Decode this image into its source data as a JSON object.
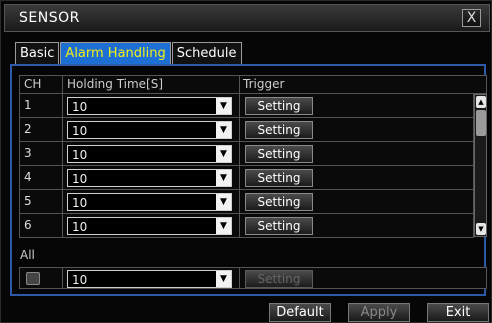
{
  "window": {
    "title": "SENSOR",
    "close_label": "X"
  },
  "tabs": [
    {
      "label": "Basic",
      "active": false
    },
    {
      "label": "Alarm Handling",
      "active": true
    },
    {
      "label": "Schedule",
      "active": false
    }
  ],
  "table": {
    "headers": {
      "ch": "CH",
      "holding_time": "Holding Time[S]",
      "trigger": "Trigger"
    },
    "rows": [
      {
        "ch": "1",
        "holding_time": "10",
        "trigger": "Setting"
      },
      {
        "ch": "2",
        "holding_time": "10",
        "trigger": "Setting"
      },
      {
        "ch": "3",
        "holding_time": "10",
        "trigger": "Setting"
      },
      {
        "ch": "4",
        "holding_time": "10",
        "trigger": "Setting"
      },
      {
        "ch": "5",
        "holding_time": "10",
        "trigger": "Setting"
      },
      {
        "ch": "6",
        "holding_time": "10",
        "trigger": "Setting"
      }
    ]
  },
  "all": {
    "label": "All",
    "holding_time": "10",
    "trigger": "Setting",
    "checked": false
  },
  "footer": {
    "default_label": "Default",
    "apply_label": "Apply",
    "exit_label": "Exit"
  },
  "colors": {
    "accent": "#1e6fd4",
    "active_tab_text": "#f2ee18",
    "panel_border": "#2c5aa8"
  }
}
